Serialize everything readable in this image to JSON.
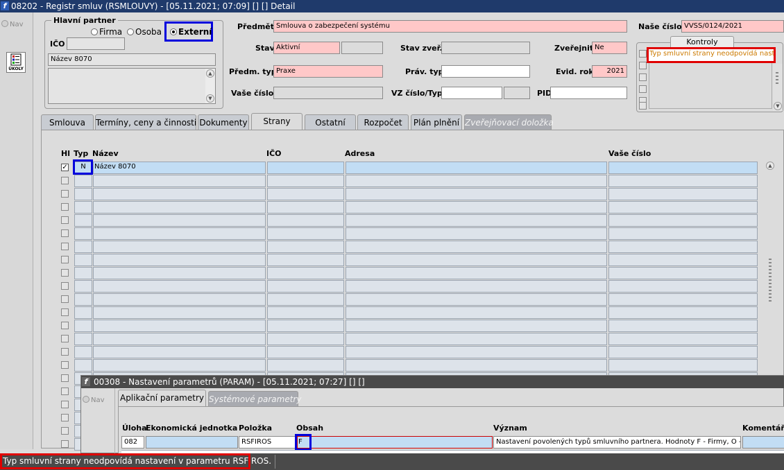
{
  "main": {
    "title": "08202 - Registr smluv (RSMLOUVY) - [05.11.2021; 07:09]  []  [] Detail",
    "nav_label": "Nav",
    "roles_label": "ÚKOLY",
    "partner": {
      "group_label": "Hlavní partner",
      "options": [
        "Firma",
        "Osoba",
        "Externí"
      ],
      "selected": "Externí",
      "ico_label": "IČO",
      "ico_value": "",
      "name_value": "Název 8070"
    },
    "fields": {
      "predmet_label": "Předmět",
      "predmet_value": "Smlouva o zabezpečení systému",
      "nase_cislo_label": "Naše číslo",
      "nase_cislo_value": "VVSS/0124/2021",
      "stav_label": "Stav",
      "stav_value": "Aktivní",
      "stav_zver_label": "Stav zveř.",
      "zverejnit_label": "Zveřejnit",
      "zverejnit_value": "Ne",
      "predm_typ_label": "Předm. typ",
      "predm_typ_value": "Praxe",
      "prav_typ_label": "Práv. typ",
      "evid_rok_label": "Evid. rok",
      "evid_rok_value": "2021",
      "vase_cislo_label": "Vaše číslo",
      "vz_label": "VZ číslo/Typ",
      "pid_label": "PID"
    },
    "kontroly": {
      "label": "Kontroly",
      "message": "Typ smluvní strany neodpovídá nastavení v parametru RSFIROS."
    },
    "tabs": [
      "Smlouva",
      "Termíny, ceny a činnosti",
      "Dokumenty",
      "Strany",
      "Ostatní",
      "Rozpočet",
      "Plán plnění",
      "Zveřejňovací doložka"
    ],
    "active_tab": "Strany",
    "grid": {
      "headers": {
        "hl": "Hl",
        "typ": "Typ",
        "nazev": "Název",
        "ico": "IČO",
        "adresa": "Adresa",
        "vase_cislo": "Vaše číslo"
      },
      "first_row": {
        "typ": "N",
        "nazev": "Název 8070"
      }
    },
    "status": "Typ smluvní strany neodpovídá nastavení v parametru RSFIROS."
  },
  "param": {
    "title": "00308 - Nastavení parametrů (PARAM) - [05.11.2021; 07:27]  []  []",
    "nav_label": "Nav",
    "tabs": [
      "Aplikační parametry",
      "Systémové parametry"
    ],
    "headers": {
      "uloha": "Úloha",
      "ek": "Ekonomická jednotka",
      "polozka": "Položka",
      "obsah": "Obsah",
      "vyznam": "Význam",
      "komentar": "Komentář"
    },
    "row": {
      "uloha": "082",
      "ek": "",
      "polozka": "RSFIROS",
      "obsah": "F",
      "vyznam": "Nastavení povolených typů smluvního partnera. Hodnoty F - Firmy, O - osoby, E - externí"
    }
  }
}
